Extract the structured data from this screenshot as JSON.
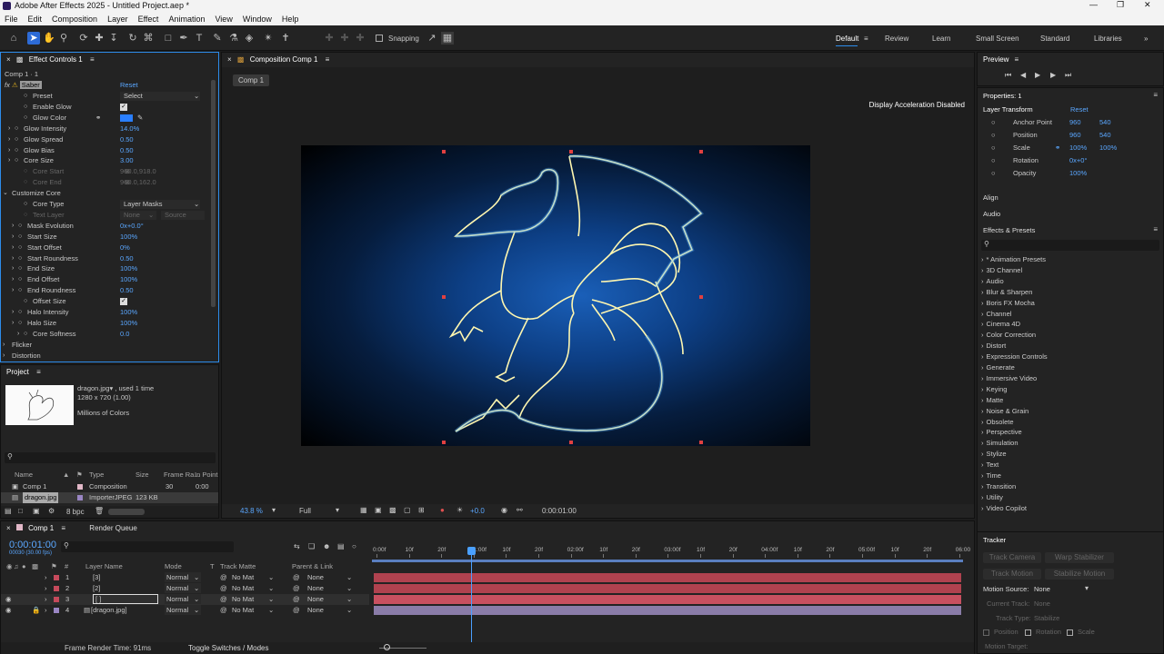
{
  "app": {
    "title": "Adobe After Effects 2025 - Untitled Project.aep *",
    "icon": "after-effects-logo"
  },
  "menu": [
    "File",
    "Edit",
    "Composition",
    "Layer",
    "Effect",
    "Animation",
    "View",
    "Window",
    "Help"
  ],
  "toolbar": {
    "snapping": "Snapping",
    "workspaces": [
      "Default",
      "Review",
      "Learn",
      "Small Screen",
      "Standard",
      "Libraries"
    ],
    "more": "»"
  },
  "effect_controls": {
    "tab": "Effect Controls 1",
    "layer": "Comp 1 · 1",
    "effect": "Saber",
    "reset": "Reset",
    "rows": [
      {
        "label": "Preset",
        "value": "Select"
      },
      {
        "label": "Enable Glow",
        "value": "✓"
      },
      {
        "label": "Glow Color",
        "value": ""
      },
      {
        "label": "Glow Intensity",
        "value": "14.0%"
      },
      {
        "label": "Glow Spread",
        "value": "0.50"
      },
      {
        "label": "Glow Bias",
        "value": "0.50"
      },
      {
        "label": "Core Size",
        "value": "3.00"
      },
      {
        "label": "Core Start",
        "value": "960.0,918.0"
      },
      {
        "label": "Core End",
        "value": "960.0,162.0"
      },
      {
        "label": "Customize Core",
        "value": ""
      },
      {
        "label": "Core Type",
        "value": "Layer Masks"
      },
      {
        "label": "Text Layer",
        "value": "None"
      },
      {
        "label": "Mask Evolution",
        "value": "0x+0.0°"
      },
      {
        "label": "Start Size",
        "value": "100%"
      },
      {
        "label": "Start Offset",
        "value": "0%"
      },
      {
        "label": "Start Roundness",
        "value": "0.50"
      },
      {
        "label": "End Size",
        "value": "100%"
      },
      {
        "label": "End Offset",
        "value": "100%"
      },
      {
        "label": "End Roundness",
        "value": "0.50"
      },
      {
        "label": "Offset Size",
        "value": "✓"
      },
      {
        "label": "Halo Intensity",
        "value": "100%"
      },
      {
        "label": "Halo Size",
        "value": "100%"
      },
      {
        "label": "Core Softness",
        "value": "0.0"
      },
      {
        "label": "Flicker",
        "value": ""
      },
      {
        "label": "Distortion",
        "value": ""
      }
    ],
    "source": "Source"
  },
  "project": {
    "tab": "Project",
    "file": "dragon.jpg▾ , used 1 time",
    "dims": "1280 x 720 (1.00)",
    "colors": "Millions of Colors",
    "cols": [
      "Name",
      "Type",
      "Size",
      "Frame Ra...",
      "In Point"
    ],
    "items": [
      {
        "name": "Comp 1",
        "type": "Composition",
        "size": "",
        "fps": "30",
        "in": "0:00"
      },
      {
        "name": "dragon.jpg",
        "type": "ImporterJPEG",
        "size": "123 KB",
        "fps": "",
        "in": ""
      }
    ],
    "bpc": "8 bpc"
  },
  "composition": {
    "tab": "Composition Comp 1",
    "breadcrumb": "Comp 1",
    "notice": "Display Acceleration Disabled",
    "zoom": "43.8 %",
    "quality": "Full",
    "time": "0:00:01:00",
    "exposure": "+0.0"
  },
  "properties": {
    "preview": "Preview",
    "title": "Properties: 1",
    "section": "Layer Transform",
    "reset": "Reset",
    "rows": [
      {
        "label": "Anchor Point",
        "v1": "960",
        "v2": "540"
      },
      {
        "label": "Position",
        "v1": "960",
        "v2": "540"
      },
      {
        "label": "Scale",
        "v1": "100%",
        "v2": "100%"
      },
      {
        "label": "Rotation",
        "v1": "0x+0°",
        "v2": ""
      },
      {
        "label": "Opacity",
        "v1": "100%",
        "v2": ""
      }
    ],
    "align": "Align",
    "audio": "Audio"
  },
  "effects_presets": {
    "title": "Effects & Presets",
    "items": [
      "* Animation Presets",
      "3D Channel",
      "Audio",
      "Blur & Sharpen",
      "Boris FX Mocha",
      "Channel",
      "Cinema 4D",
      "Color Correction",
      "Distort",
      "Expression Controls",
      "Generate",
      "Immersive Video",
      "Keying",
      "Matte",
      "Noise & Grain",
      "Obsolete",
      "Perspective",
      "Simulation",
      "Stylize",
      "Text",
      "Time",
      "Transition",
      "Utility",
      "Video Copilot"
    ]
  },
  "tracker": {
    "title": "Tracker",
    "track_camera": "Track Camera",
    "warp": "Warp Stabilizer",
    "track_motion": "Track Motion",
    "stabilize": "Stabilize Motion",
    "motion_source_label": "Motion Source:",
    "motion_source": "None",
    "current_track": "Current Track:",
    "current_track_val": "None",
    "track_type": "Track Type:",
    "track_type_val": "Stabilize",
    "position": "Position",
    "rotation": "Rotation",
    "scale": "Scale",
    "motion_target": "Motion Target:"
  },
  "timeline": {
    "tab": "Comp 1",
    "render_queue": "Render Queue",
    "time": "0:00:01:00",
    "fps": "00030 (30.00 fps)",
    "cols": [
      "#",
      "Layer Name",
      "Mode",
      "T",
      "Track Matte",
      "Parent & Link"
    ],
    "layers": [
      {
        "num": "1",
        "name": "[3]",
        "mode": "Normal",
        "matte": "No Mat",
        "parent": "None"
      },
      {
        "num": "2",
        "name": "[2]",
        "mode": "Normal",
        "matte": "No Mat",
        "parent": "None"
      },
      {
        "num": "3",
        "name": "[ ]",
        "mode": "Normal",
        "matte": "No Mat",
        "parent": "None"
      },
      {
        "num": "4",
        "name": "[dragon.jpg]",
        "mode": "Normal",
        "matte": "No Mat",
        "parent": "None"
      }
    ],
    "ruler": [
      "0:00f",
      "10f",
      "20f",
      "01:00f",
      "10f",
      "20f",
      "02:00f",
      "10f",
      "20f",
      "03:00f",
      "10f",
      "20f",
      "04:00f",
      "10f",
      "20f",
      "05:00f",
      "10f",
      "20f",
      "06:00"
    ],
    "render_time": "Frame Render Time: 91ms",
    "toggle": "Toggle Switches / Modes"
  }
}
